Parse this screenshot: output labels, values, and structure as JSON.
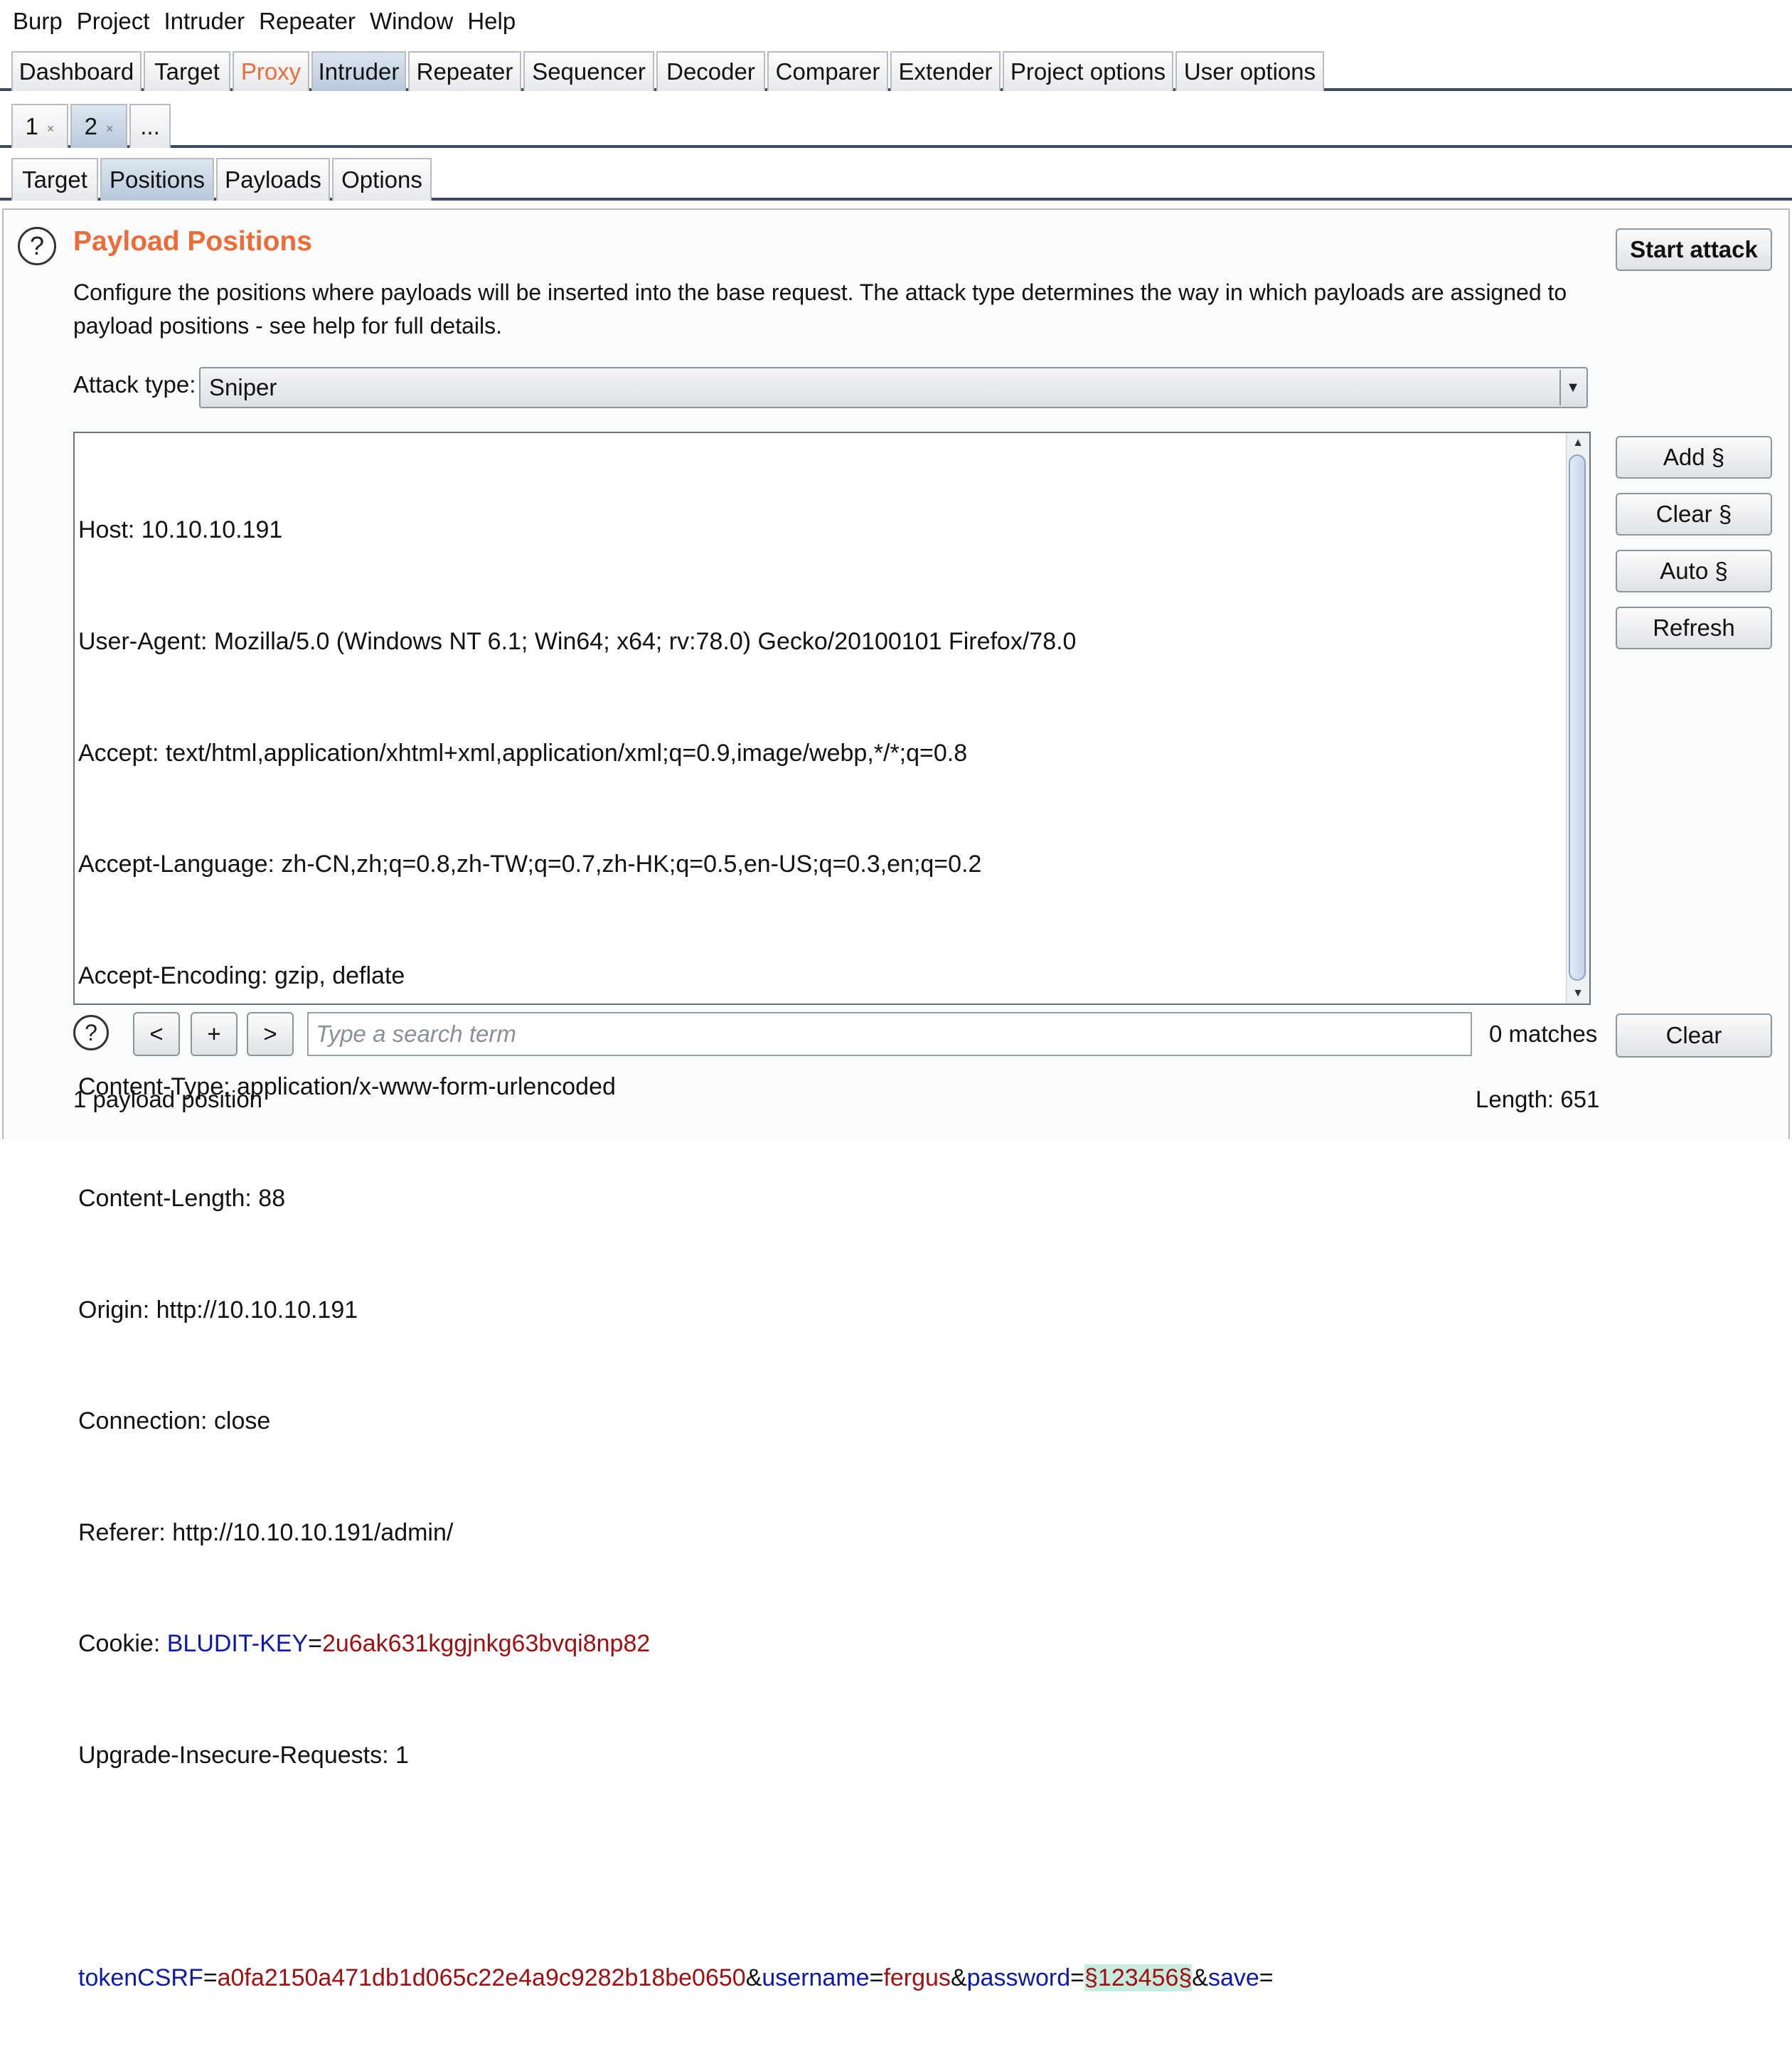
{
  "menu": [
    "Burp",
    "Project",
    "Intruder",
    "Repeater",
    "Window",
    "Help"
  ],
  "main_tabs": [
    {
      "label": "Dashboard"
    },
    {
      "label": "Target"
    },
    {
      "label": "Proxy"
    },
    {
      "label": "Intruder"
    },
    {
      "label": "Repeater"
    },
    {
      "label": "Sequencer"
    },
    {
      "label": "Decoder"
    },
    {
      "label": "Comparer"
    },
    {
      "label": "Extender"
    },
    {
      "label": "Project options"
    },
    {
      "label": "User options"
    }
  ],
  "active_main_tab": "Intruder",
  "attack_tabs": [
    {
      "label": "1",
      "close": "×"
    },
    {
      "label": "2",
      "close": "×"
    },
    {
      "label": "..."
    }
  ],
  "sub_tabs": [
    {
      "label": "Target"
    },
    {
      "label": "Positions"
    },
    {
      "label": "Payloads"
    },
    {
      "label": "Options"
    }
  ],
  "active_sub_tab": "Positions",
  "panel": {
    "help_glyph": "?",
    "title": "Payload Positions",
    "description": "Configure the positions where payloads will be inserted into the base request. The attack type determines the way in which payloads are assigned to payload positions - see help for full details.",
    "start_attack": "Start attack",
    "attack_type_label": "Attack type:",
    "attack_type_value": "Sniper"
  },
  "request": {
    "host": {
      "name": "Host:",
      "value": " 10.10.10.191"
    },
    "user_agent": {
      "name": "User-Agent:",
      "value": " Mozilla/5.0 (Windows NT 6.1; Win64; x64; rv:78.0) Gecko/20100101 Firefox/78.0"
    },
    "accept": {
      "name": "Accept:",
      "value": " text/html,application/xhtml+xml,application/xml;q=0.9,image/webp,*/*;q=0.8"
    },
    "accept_language": {
      "name": "Accept-Language:",
      "value": " zh-CN,zh;q=0.8,zh-TW;q=0.7,zh-HK;q=0.5,en-US;q=0.3,en;q=0.2"
    },
    "accept_encoding": {
      "name": "Accept-Encoding:",
      "value": " gzip, deflate"
    },
    "content_type": {
      "name": "Content-Type:",
      "value": " application/x-www-form-urlencoded"
    },
    "content_length": {
      "name": "Content-Length:",
      "value": " 88"
    },
    "origin": {
      "name": "Origin:",
      "value": " http://10.10.10.191"
    },
    "connection": {
      "name": "Connection:",
      "value": " close"
    },
    "referer": {
      "name": "Referer:",
      "value": " http://10.10.10.191/admin/"
    },
    "cookie": {
      "name": "Cookie:",
      "cookie_name": "BLUDIT-KEY",
      "eq": "=",
      "cookie_value": "2u6ak631kggjnkg63bvqi8np82"
    },
    "upgrade": {
      "name": "Upgrade-Insecure-Requests:",
      "value": " 1"
    },
    "body": {
      "k1": "tokenCSRF",
      "eq": "=",
      "v1": "a0fa2150a471db1d065c22e4a9c9282b18be0650",
      "amp": "&",
      "k2": "username",
      "v2": "fergus",
      "k3": "password",
      "marker": "§123456§",
      "k4": "save"
    }
  },
  "side_buttons": {
    "add": "Add §",
    "clear": "Clear §",
    "auto": "Auto §",
    "refresh": "Refresh"
  },
  "search": {
    "prev": "<",
    "add": "+",
    "next": ">",
    "placeholder": "Type a search term",
    "matches": "0 matches",
    "clear": "Clear"
  },
  "status": {
    "positions": "1 payload position",
    "length": "Length: 651"
  }
}
